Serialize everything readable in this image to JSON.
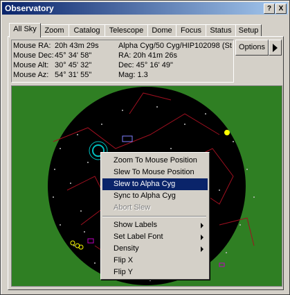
{
  "window": {
    "title": "Observatory",
    "help_btn": "?",
    "close_btn": "X"
  },
  "tabs": [
    "All Sky",
    "Zoom",
    "Catalog",
    "Telescope",
    "Dome",
    "Focus",
    "Status",
    "Setup"
  ],
  "active_tab": "All Sky",
  "info": {
    "mouse_ra_label": "Mouse RA:",
    "mouse_ra": "20h 43m 29s",
    "mouse_dec_label": "Mouse Dec:",
    "mouse_dec": "45° 34' 58\"",
    "mouse_alt_label": "Mouse Alt:",
    "mouse_alt": "30° 45' 32\"",
    "mouse_az_label": "Mouse Az:",
    "mouse_az": "54° 31' 55\"",
    "object_name": "Alpha Cyg/50 Cyg/HIP102098 (St",
    "obj_ra": "RA: 20h 41m 26s",
    "obj_dec": "Dec: 45° 16' 49\"",
    "obj_mag": "Mag: 1.3"
  },
  "options_btn": "Options",
  "context_menu": [
    {
      "label": "Zoom To Mouse Position"
    },
    {
      "label": "Slew To Mouse Position"
    },
    {
      "label": "Slew to Alpha Cyg",
      "selected": true
    },
    {
      "label": "Sync to Alpha Cyg"
    },
    {
      "label": "Abort Slew",
      "disabled": true
    },
    {
      "label": "Show Labels",
      "submenu": true
    },
    {
      "label": "Set Label Font",
      "submenu": true
    },
    {
      "label": "Density",
      "submenu": true
    },
    {
      "label": "Flip X"
    },
    {
      "label": "Flip Y"
    }
  ],
  "colors": {
    "sky_bg": "#2f7f23",
    "sky_disc": "#000000",
    "titlebar": "#0a246a",
    "menu_highlight": "#0a246a"
  }
}
